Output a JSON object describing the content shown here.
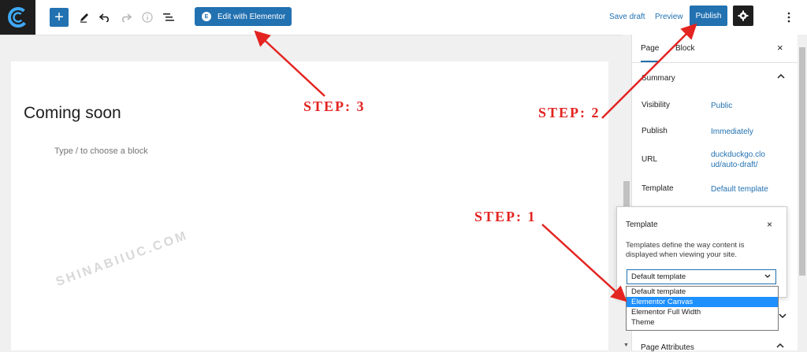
{
  "toolbar": {
    "add_block_label": "+",
    "edit_with_elementor_label": "Edit with Elementor",
    "elementor_badge": "E",
    "save_draft_label": "Save draft",
    "preview_label": "Preview",
    "publish_label": "Publish"
  },
  "icons": {
    "logo": "site-logo-icon",
    "pen": "pen-icon",
    "undo": "undo-icon",
    "redo": "redo-icon",
    "info": "info-icon",
    "list_view": "list-view-icon",
    "settings": "gear-icon",
    "more": "more-vertical-icon"
  },
  "editor": {
    "post_title": "Coming soon",
    "block_hint": "Type / to choose a block",
    "watermark": "SHINABIIUC.COM"
  },
  "sidebar": {
    "tabs": [
      {
        "label": "Page",
        "active": true
      },
      {
        "label": "Block",
        "active": false
      }
    ],
    "close_label": "×",
    "summary_title": "Summary",
    "rows": [
      {
        "label": "Visibility",
        "value": "Public"
      },
      {
        "label": "Publish",
        "value": "Immediately"
      },
      {
        "label": "URL",
        "value": "duckduckgo.cloud/auto-draft/"
      },
      {
        "label": "Template",
        "value": "Default template"
      }
    ],
    "page_attributes_title": "Page Attributes"
  },
  "template_popover": {
    "title": "Template",
    "close_label": "×",
    "description": "Templates define the way content is displayed when viewing your site.",
    "selected_value": "Default template",
    "options": [
      {
        "label": "Default template",
        "highlighted": false
      },
      {
        "label": "Elementor Canvas",
        "highlighted": true
      },
      {
        "label": "Elementor Full Width",
        "highlighted": false
      },
      {
        "label": "Theme",
        "highlighted": false
      }
    ]
  },
  "annotations": {
    "step1": "STEP: 1",
    "step2": "STEP: 2",
    "step3": "STEP: 3"
  },
  "colors": {
    "accent": "#2271b1",
    "annotation_red": "#e32421",
    "highlight": "#1e90ff",
    "dark": "#1e1e1e"
  }
}
